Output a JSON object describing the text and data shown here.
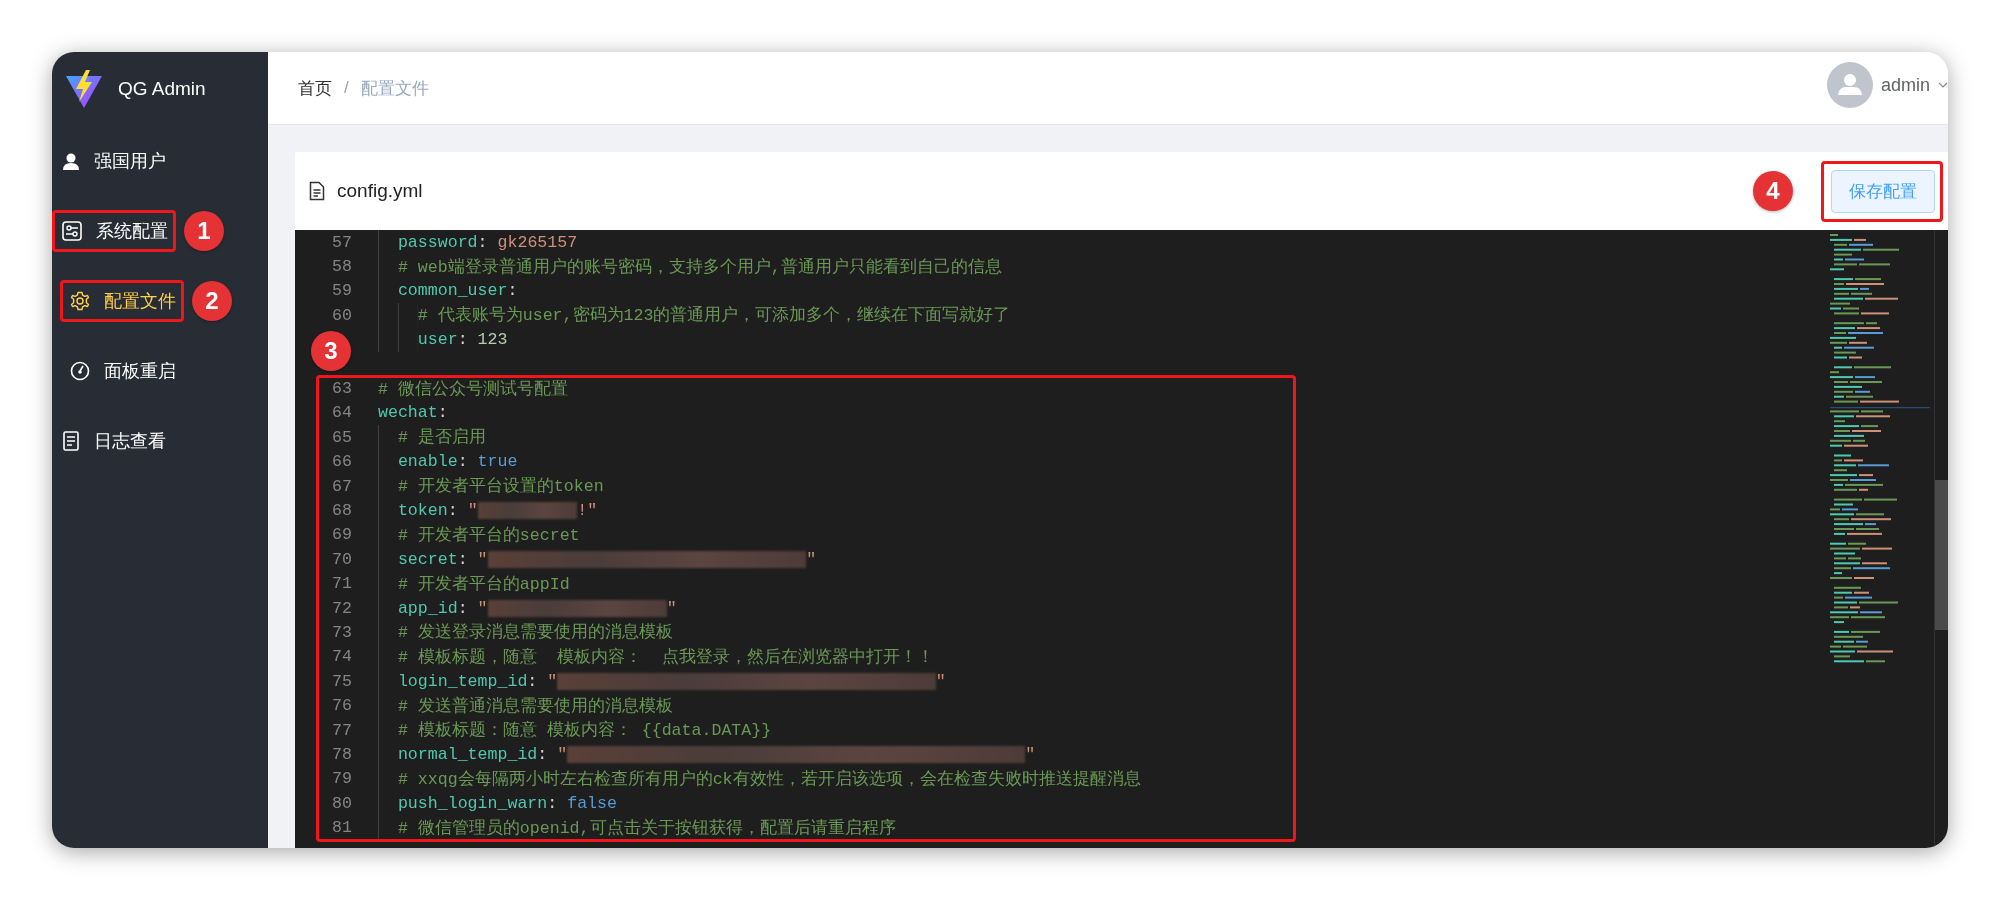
{
  "app": {
    "title": "QG Admin"
  },
  "sidebar": {
    "items": [
      {
        "label": "强国用户",
        "selected": false
      },
      {
        "label": "系统配置",
        "selected": false,
        "callout": {
          "number": "1",
          "kind": "right"
        },
        "children": [
          {
            "label": "配置文件",
            "selected": true,
            "callout": {
              "number": "2",
              "kind": "right"
            }
          },
          {
            "label": "面板重启",
            "selected": false
          }
        ]
      },
      {
        "label": "日志查看",
        "selected": false
      }
    ]
  },
  "header": {
    "breadcrumb": [
      {
        "label": "首页",
        "current": false
      },
      {
        "label": "配置文件",
        "current": true
      }
    ],
    "separator": "/",
    "user": {
      "name": "admin"
    }
  },
  "card": {
    "title": "config.yml",
    "save_button": {
      "label": "保存配置",
      "callout": {
        "number": "4",
        "kind": "left"
      }
    }
  },
  "editor": {
    "callout": {
      "number": "3",
      "kind": "above"
    },
    "lines": [
      {
        "number": "57",
        "kind": "child",
        "in_callout": false,
        "segments": [
          {
            "kind": "key",
            "text": "password"
          },
          {
            "kind": "punct",
            "text": ":"
          },
          {
            "kind": "string",
            "text": " gk265157"
          }
        ]
      },
      {
        "number": "58",
        "kind": "child",
        "in_callout": false,
        "segments": [
          {
            "kind": "comment",
            "text": "# web端登录普通用户的账号密码，支持多个用户,普通用户只能看到自己的信息"
          }
        ]
      },
      {
        "number": "59",
        "kind": "child",
        "in_callout": false,
        "segments": [
          {
            "kind": "key",
            "text": "common_user"
          },
          {
            "kind": "punct",
            "text": ":"
          }
        ]
      },
      {
        "number": "60",
        "kind": "grandchild",
        "in_callout": false,
        "segments": [
          {
            "kind": "comment",
            "text": "# 代表账号为user,密码为123的普通用户，可添加多个，继续在下面写就好了"
          }
        ]
      },
      {
        "kind": "grandchild",
        "in_callout": false,
        "segments": [
          {
            "kind": "key",
            "text": "user"
          },
          {
            "kind": "punct",
            "text": ":"
          },
          {
            "kind": "number",
            "text": " 123"
          }
        ]
      },
      {
        "kind": "blank"
      },
      {
        "number": "63",
        "kind": "root",
        "in_callout": true,
        "segments": [
          {
            "kind": "comment",
            "text": "# 微信公众号测试号配置"
          }
        ]
      },
      {
        "number": "64",
        "kind": "root",
        "in_callout": true,
        "segments": [
          {
            "kind": "key",
            "text": "wechat"
          },
          {
            "kind": "punct",
            "text": ":"
          }
        ]
      },
      {
        "number": "65",
        "kind": "child",
        "in_callout": true,
        "segments": [
          {
            "kind": "comment",
            "text": "# 是否启用"
          }
        ]
      },
      {
        "number": "66",
        "kind": "child",
        "in_callout": true,
        "segments": [
          {
            "kind": "key",
            "text": "enable"
          },
          {
            "kind": "punct",
            "text": ":"
          },
          {
            "kind": "bool",
            "text": " true"
          }
        ]
      },
      {
        "number": "67",
        "kind": "child",
        "in_callout": true,
        "segments": [
          {
            "kind": "comment",
            "text": "# 开发者平台设置的token"
          }
        ]
      },
      {
        "number": "68",
        "kind": "child",
        "in_callout": true,
        "segments": [
          {
            "kind": "key",
            "text": "token"
          },
          {
            "kind": "punct",
            "text": ":"
          },
          {
            "kind": "string",
            "text": " \""
          },
          {
            "kind": "maskS"
          },
          {
            "kind": "string",
            "text": "!\""
          }
        ]
      },
      {
        "number": "69",
        "kind": "child",
        "in_callout": true,
        "segments": [
          {
            "kind": "comment",
            "text": "# 开发者平台的secret"
          }
        ]
      },
      {
        "number": "70",
        "kind": "child",
        "in_callout": true,
        "segments": [
          {
            "kind": "key",
            "text": "secret"
          },
          {
            "kind": "punct",
            "text": ":"
          },
          {
            "kind": "string",
            "text": " \""
          },
          {
            "kind": "maskL"
          },
          {
            "kind": "string",
            "text": "\""
          }
        ]
      },
      {
        "number": "71",
        "kind": "child",
        "in_callout": true,
        "segments": [
          {
            "kind": "comment",
            "text": "# 开发者平台的appId"
          }
        ]
      },
      {
        "number": "72",
        "kind": "child",
        "in_callout": true,
        "segments": [
          {
            "kind": "key",
            "text": "app_id"
          },
          {
            "kind": "punct",
            "text": ":"
          },
          {
            "kind": "string",
            "text": " \""
          },
          {
            "kind": "maskM"
          },
          {
            "kind": "string",
            "text": "\""
          }
        ]
      },
      {
        "number": "73",
        "kind": "child",
        "in_callout": true,
        "segments": [
          {
            "kind": "comment",
            "text": "# 发送登录消息需要使用的消息模板"
          }
        ]
      },
      {
        "number": "74",
        "kind": "child",
        "in_callout": true,
        "segments": [
          {
            "kind": "comment",
            "text": "# 模板标题，随意  模板内容：  点我登录，然后在浏览器中打开！！"
          }
        ]
      },
      {
        "number": "75",
        "kind": "child",
        "in_callout": true,
        "segments": [
          {
            "kind": "key",
            "text": "login_temp_id"
          },
          {
            "kind": "punct",
            "text": ":"
          },
          {
            "kind": "string",
            "text": " \""
          },
          {
            "kind": "maskXL"
          },
          {
            "kind": "string",
            "text": "\""
          }
        ]
      },
      {
        "number": "76",
        "kind": "child",
        "in_callout": true,
        "segments": [
          {
            "kind": "comment",
            "text": "# 发送普通消息需要使用的消息模板"
          }
        ]
      },
      {
        "number": "77",
        "kind": "child",
        "in_callout": true,
        "segments": [
          {
            "kind": "comment",
            "text": "# 模板标题：随意 模板内容： {{data.DATA}}"
          }
        ]
      },
      {
        "number": "78",
        "kind": "child",
        "in_callout": true,
        "segments": [
          {
            "kind": "key",
            "text": "normal_temp_id"
          },
          {
            "kind": "punct",
            "text": ":"
          },
          {
            "kind": "string",
            "text": " \""
          },
          {
            "kind": "maskXXL"
          },
          {
            "kind": "string",
            "text": "\""
          }
        ]
      },
      {
        "number": "79",
        "kind": "child",
        "in_callout": true,
        "segments": [
          {
            "kind": "comment",
            "text": "# xxqg会每隔两小时左右检查所有用户的ck有效性，若开启该选项，会在检查失败时推送提醒消息"
          }
        ]
      },
      {
        "number": "80",
        "kind": "child",
        "in_callout": true,
        "segments": [
          {
            "kind": "key",
            "text": "push_login_warn"
          },
          {
            "kind": "punct",
            "text": ":"
          },
          {
            "kind": "bool",
            "text": " false"
          }
        ]
      },
      {
        "number": "81",
        "kind": "child",
        "in_callout": true,
        "segments": [
          {
            "kind": "comment",
            "text": "# 微信管理员的openid,可点击关于按钮获得，配置后请重启程序"
          }
        ]
      }
    ]
  }
}
